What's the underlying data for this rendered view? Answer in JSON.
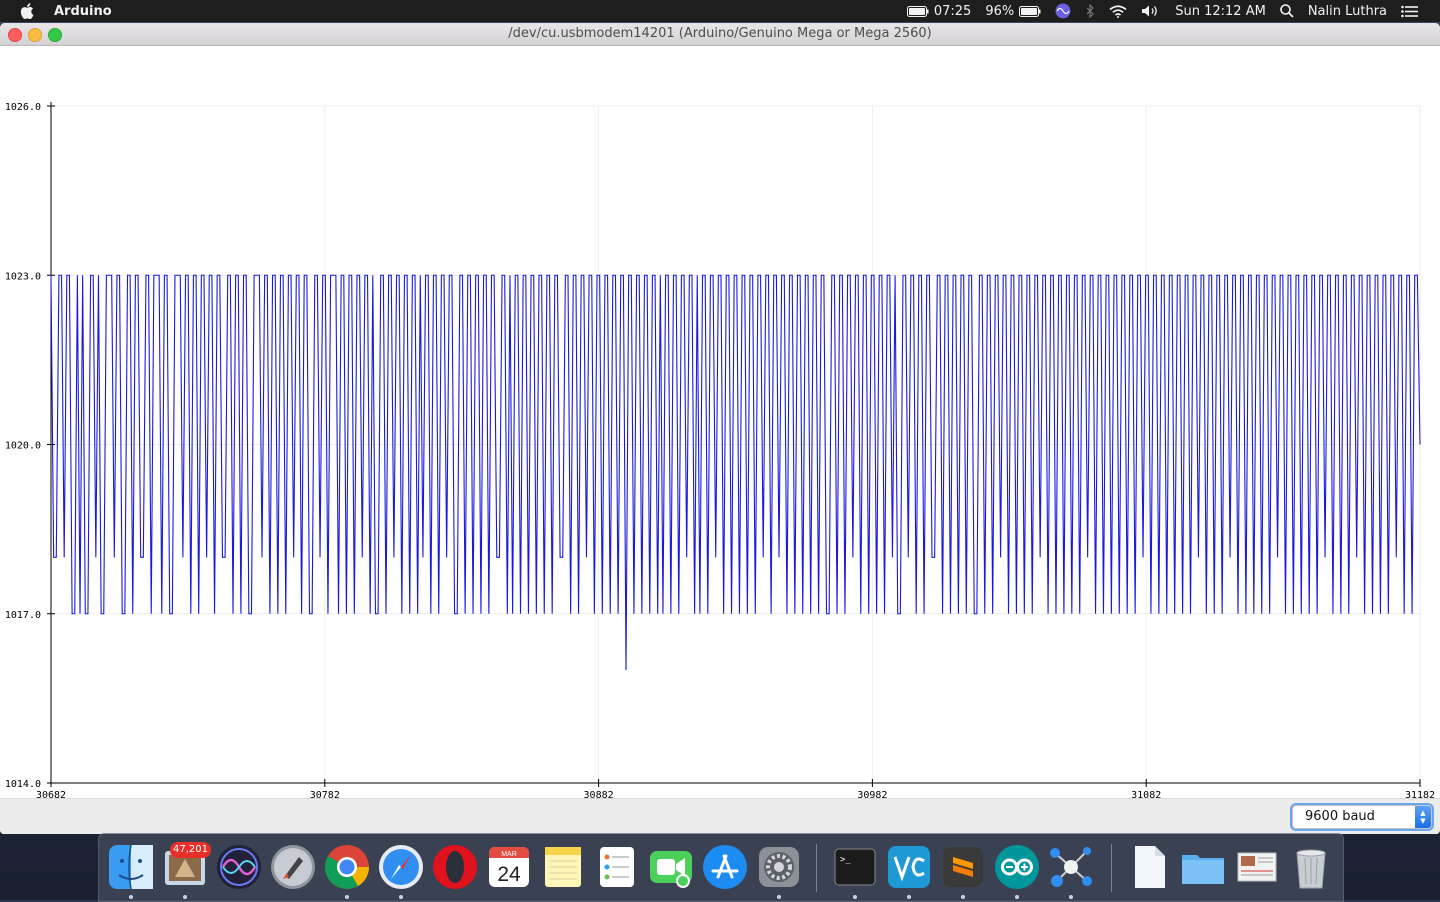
{
  "menubar": {
    "app_name": "Arduino",
    "battery_time": "07:25",
    "battery_percent": "96%",
    "datetime": "Sun 12:12 AM",
    "user": "Nalin Luthra"
  },
  "window": {
    "title": "/dev/cu.usbmodem14201 (Arduino/Genuino Mega or Mega 2560)"
  },
  "footer": {
    "baud": "9600 baud"
  },
  "dock": {
    "mail_badge": "47,201",
    "calendar_month": "MAR",
    "calendar_day": "24",
    "apps": [
      "Finder",
      "Mail",
      "Siri",
      "Launchpad",
      "Chrome",
      "Safari",
      "Opera",
      "Calendar",
      "Notes",
      "Reminders",
      "FaceTime",
      "App Store",
      "System Preferences",
      "Terminal",
      "VNC Viewer",
      "Sublime Text",
      "Arduino",
      "Molecule",
      "Document",
      "Folder",
      "Preview",
      "Trash"
    ]
  },
  "colors": {
    "series": "#1a1adf",
    "grid": "#eeeeee"
  },
  "chart_data": {
    "type": "line",
    "title": "",
    "xlabel": "",
    "ylabel": "",
    "xlim": [
      30682,
      31182
    ],
    "ylim": [
      1014.0,
      1026.0
    ],
    "x_ticks": [
      30682,
      30782,
      30882,
      30982,
      31082,
      31182
    ],
    "y_ticks": [
      "1014.0",
      "1017.0",
      "1020.0",
      "1023.0",
      "1026.0"
    ],
    "grid": true,
    "legend": "none",
    "series": [
      {
        "x_start": 30682,
        "x_step": 1,
        "values": [
          1023,
          1018,
          1018,
          1023,
          1023,
          1018,
          1023,
          1023,
          1017,
          1017,
          1023,
          1017,
          1023,
          1017,
          1017,
          1023,
          1023,
          1018,
          1023,
          1017,
          1017,
          1023,
          1023,
          1023,
          1018,
          1023,
          1023,
          1017,
          1017,
          1023,
          1023,
          1017,
          1023,
          1023,
          1018,
          1018,
          1023,
          1023,
          1017,
          1023,
          1023,
          1023,
          1017,
          1023,
          1023,
          1017,
          1017,
          1023,
          1023,
          1023,
          1018,
          1023,
          1023,
          1017,
          1023,
          1023,
          1017,
          1023,
          1023,
          1018,
          1023,
          1023,
          1017,
          1023,
          1023,
          1018,
          1018,
          1023,
          1023,
          1017,
          1023,
          1023,
          1017,
          1023,
          1023,
          1017,
          1017,
          1023,
          1023,
          1023,
          1018,
          1023,
          1023,
          1017,
          1023,
          1023,
          1017,
          1023,
          1023,
          1017,
          1023,
          1023,
          1018,
          1023,
          1023,
          1017,
          1023,
          1023,
          1017,
          1017,
          1023,
          1023,
          1018,
          1023,
          1023,
          1017,
          1023,
          1023,
          1023,
          1017,
          1023,
          1023,
          1017,
          1023,
          1023,
          1017,
          1023,
          1023,
          1018,
          1023,
          1023,
          1017,
          1023,
          1017,
          1017,
          1023,
          1023,
          1017,
          1023,
          1023,
          1018,
          1023,
          1023,
          1017,
          1023,
          1023,
          1017,
          1023,
          1023,
          1017,
          1023,
          1018,
          1023,
          1023,
          1017,
          1023,
          1023,
          1017,
          1023,
          1023,
          1018,
          1023,
          1023,
          1017,
          1017,
          1023,
          1023,
          1017,
          1023,
          1023,
          1017,
          1023,
          1023,
          1017,
          1023,
          1023,
          1017,
          1023,
          1023,
          1018,
          1018,
          1023,
          1023,
          1017,
          1023,
          1017,
          1023,
          1023,
          1017,
          1023,
          1023,
          1017,
          1023,
          1023,
          1017,
          1023,
          1023,
          1017,
          1023,
          1023,
          1017,
          1023,
          1023,
          1018,
          1018,
          1023,
          1023,
          1017,
          1023,
          1023,
          1017,
          1023,
          1023,
          1018,
          1023,
          1023,
          1017,
          1023,
          1023,
          1017,
          1023,
          1023,
          1017,
          1023,
          1023,
          1017,
          1023,
          1023,
          1016,
          1023,
          1023,
          1017,
          1023,
          1023,
          1017,
          1023,
          1023,
          1017,
          1023,
          1023,
          1017,
          1023,
          1017,
          1023,
          1023,
          1017,
          1023,
          1023,
          1017,
          1023,
          1023,
          1018,
          1023,
          1023,
          1017,
          1023,
          1017,
          1023,
          1023,
          1017,
          1023,
          1023,
          1018,
          1023,
          1023,
          1017,
          1023,
          1023,
          1017,
          1023,
          1023,
          1017,
          1023,
          1023,
          1017,
          1023,
          1023,
          1017,
          1023,
          1023,
          1018,
          1023,
          1023,
          1017,
          1023,
          1023,
          1018,
          1023,
          1023,
          1017,
          1023,
          1023,
          1017,
          1023,
          1023,
          1017,
          1023,
          1023,
          1017,
          1023,
          1023,
          1017,
          1023,
          1023,
          1017,
          1017,
          1023,
          1023,
          1017,
          1023,
          1023,
          1017,
          1023,
          1023,
          1018,
          1023,
          1023,
          1017,
          1023,
          1023,
          1017,
          1023,
          1023,
          1017,
          1023,
          1023,
          1017,
          1023,
          1023,
          1018,
          1023,
          1017,
          1017,
          1023,
          1023,
          1018,
          1023,
          1023,
          1017,
          1023,
          1023,
          1017,
          1023,
          1023,
          1018,
          1018,
          1023,
          1023,
          1017,
          1023,
          1023,
          1017,
          1023,
          1023,
          1017,
          1023,
          1023,
          1017,
          1023,
          1023,
          1017,
          1017,
          1023,
          1023,
          1017,
          1023,
          1023,
          1017,
          1023,
          1023,
          1018,
          1023,
          1023,
          1017,
          1023,
          1023,
          1017,
          1023,
          1023,
          1017,
          1023,
          1023,
          1017,
          1023,
          1023,
          1018,
          1023,
          1023,
          1017,
          1023,
          1023,
          1017,
          1023,
          1023,
          1017,
          1023,
          1023,
          1017,
          1023,
          1023,
          1017,
          1023,
          1023,
          1018,
          1023,
          1023,
          1017,
          1023,
          1023,
          1017,
          1023,
          1023,
          1017,
          1023,
          1023,
          1017,
          1023,
          1023,
          1017,
          1023,
          1023,
          1017,
          1023,
          1023,
          1018,
          1023,
          1023,
          1017,
          1023,
          1023,
          1017,
          1023,
          1023,
          1017,
          1023,
          1023,
          1017,
          1023,
          1023,
          1017,
          1023,
          1023,
          1017,
          1023,
          1023,
          1018,
          1023,
          1023,
          1017,
          1023,
          1023,
          1017,
          1023,
          1023,
          1017,
          1023,
          1023,
          1018,
          1023,
          1023,
          1017,
          1023,
          1023,
          1017,
          1023,
          1023,
          1017,
          1023,
          1023,
          1017,
          1023,
          1023,
          1017,
          1023,
          1023,
          1018,
          1023,
          1023,
          1017,
          1023,
          1023,
          1017,
          1023,
          1023,
          1017,
          1023,
          1023,
          1017,
          1023,
          1023,
          1017,
          1023,
          1023,
          1018,
          1023,
          1023,
          1017,
          1023,
          1023,
          1017,
          1023,
          1023,
          1017,
          1023,
          1023,
          1018,
          1023,
          1023,
          1017,
          1023,
          1023,
          1017,
          1023,
          1023,
          1017,
          1023,
          1023,
          1017,
          1023,
          1023,
          1018,
          1023,
          1023,
          1017,
          1023,
          1023,
          1017,
          1023,
          1023,
          1020
        ]
      }
    ]
  }
}
